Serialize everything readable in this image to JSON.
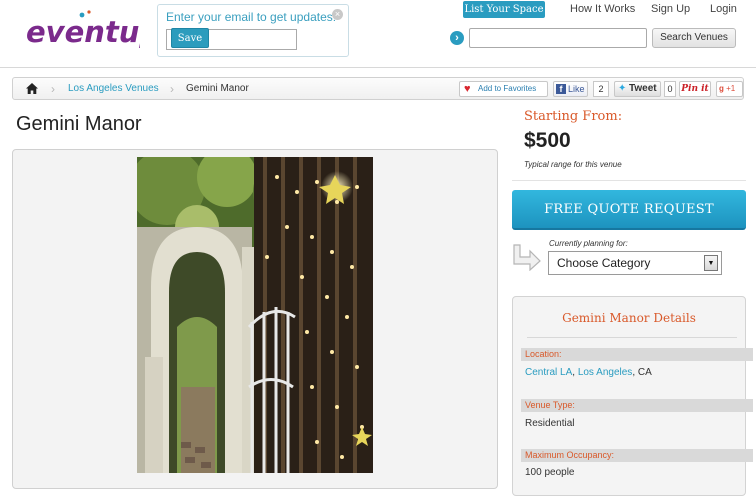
{
  "header": {
    "logo_text": "eventup",
    "signup": {
      "prompt": "Enter your email to get updates!",
      "email_value": "",
      "save_label": "Save",
      "close_glyph": "×"
    },
    "nav": {
      "list_space": "List Your Space",
      "how_it_works": "How It Works",
      "sign_up": "Sign Up",
      "login": "Login"
    },
    "search": {
      "go_icon": "arrow-right-circle-icon",
      "value": "",
      "button_label": "Search Venues"
    }
  },
  "breadcrumb": {
    "home_icon": "home-icon",
    "separator": "›",
    "items": [
      "Los Angeles Venues",
      "Gemini Manor"
    ]
  },
  "social": {
    "favorites_label": "Add to Favorites",
    "fb_like_label": "Like",
    "fb_count": "2",
    "tweet_label": "Tweet",
    "tweet_count": "0",
    "pinit_label": "Pin it",
    "gplus_label": "+1"
  },
  "venue": {
    "title": "Gemini Manor",
    "photo_icon": "venue-photo"
  },
  "pricing": {
    "starting_label": "Starting From:",
    "price": "$500",
    "typical_range": "Typical range for this venue"
  },
  "quote": {
    "button_label": "FREE QUOTE REQUEST",
    "planning_label": "Currently planning for:",
    "category_value": "Choose Category",
    "category_arrow": "▼"
  },
  "details": {
    "title": "Gemini Manor Details",
    "location_label": "Location:",
    "location_area": "Central LA",
    "location_city": "Los Angeles",
    "location_state": "CA",
    "comma": ",",
    "venue_type_label": "Venue Type:",
    "venue_type_value": "Residential",
    "max_occupancy_label": "Maximum Occupancy:",
    "max_occupancy_value": "100 people"
  },
  "colors": {
    "brand_purple": "#7b2a8c",
    "accent_blue": "#2a9cc0",
    "accent_orange": "#d9592a"
  }
}
